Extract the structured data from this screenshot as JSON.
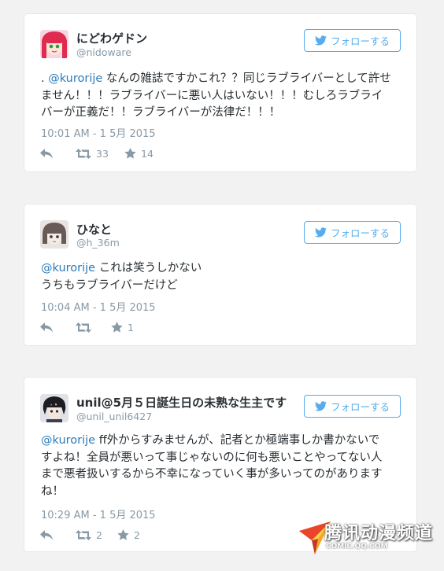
{
  "tweets": [
    {
      "display_name": "にどわゲドン",
      "handle": "@nidoware",
      "follow_label": "フォローする",
      "lines": [
        [
          ". ",
          "@kurorije",
          " なんの雑誌ですかこれ？？同じラブライバーとして許せ"
        ],
        [
          "ません！！！ラブライバーに悪い人はいない！！！むしろラブライ"
        ],
        [
          "バーが正義だ！！ラブライバーが法律だ！！！"
        ]
      ],
      "timestamp": "10:01 AM - 1 5月 2015",
      "retweets": "33",
      "favorites": "14"
    },
    {
      "display_name": "ひなと",
      "handle": "@h_36m",
      "follow_label": "フォローする",
      "lines": [
        [
          "",
          "@kurorije",
          " これは笑うしかない"
        ],
        [
          "うちもラブライバーだけど"
        ]
      ],
      "timestamp": "10:04 AM - 1 5月 2015",
      "retweets": "",
      "favorites": "1"
    },
    {
      "display_name": "unil@5月５日誕生日の未熟な生主です",
      "handle": "@unil_unil6427",
      "follow_label": "フォローする",
      "lines": [
        [
          "",
          "@kurorije",
          " ff外からすみませんが、記者とか極端事しか書かないで"
        ],
        [
          "すよね！全員が悪いって事じゃないのに何も悪いことやってない人"
        ],
        [
          "まで悪者扱いするから不幸になっていく事が多いってのがあります"
        ],
        [
          "ね！"
        ]
      ],
      "timestamp": "10:29 AM - 1 5月 2015",
      "retweets": "2",
      "favorites": "2"
    }
  ],
  "watermark": {
    "title": "腾讯动漫频道",
    "subtitle": "COMIC.QQ.COM"
  },
  "colors": {
    "accent": "#55acee",
    "mention": "#2b7bb9",
    "muted": "#8899a6",
    "text": "#292f33"
  },
  "icons": [
    "twitter-bird-icon",
    "reply-icon",
    "retweet-icon",
    "favorite-star-icon"
  ]
}
